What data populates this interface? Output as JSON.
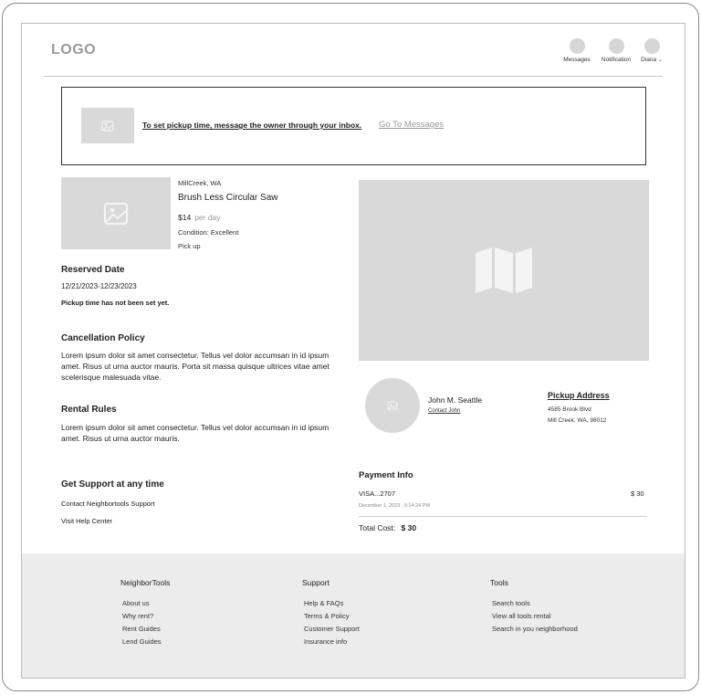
{
  "header": {
    "logo": "LOGO",
    "nav": [
      {
        "label": "Messages",
        "icon": "messages-icon"
      },
      {
        "label": "Notification",
        "icon": "notification-icon"
      },
      {
        "label": "Diana",
        "icon": "user-avatar-icon"
      }
    ]
  },
  "banner": {
    "message": "To set pickup time, message the owner through your inbox.",
    "link": "Go To Messages"
  },
  "item": {
    "location": "MillCreek, WA",
    "name": "Brush Less Circular Saw",
    "price": "$14",
    "price_unit": "per day",
    "condition": "Condition: Excellent",
    "pickup": "Pick up"
  },
  "reserved": {
    "title": "Reserved Date",
    "dates": "12/21/2023-12/23/2023",
    "note": "Pickup time has not been set yet."
  },
  "cancellation": {
    "title": "Cancellation Policy",
    "text": "Lorem ipsum dolor sit amet consectetur. Tellus vel dolor accumsan in id ipsum amet. Risus ut urna auctor mauris. Porta sit massa quisque ultrices vitae amet scelerisque malesuada vitae."
  },
  "rules": {
    "title": "Rental Rules",
    "text": "Lorem ipsum dolor sit amet consectetur. Tellus vel dolor accumsan in id ipsum amet. Risus ut urna auctor mauris."
  },
  "support": {
    "title": "Get Support at any time",
    "contact": "Contact Neighbortools Support",
    "help": "Visit Help Center"
  },
  "owner": {
    "name": "John M. Seattle",
    "contact": "Contact John"
  },
  "address": {
    "title": "Pickup Address",
    "line1": "4585 Brook Blvd",
    "line2": "Mill Creek, WA, 98012"
  },
  "payment": {
    "title": "Payment Info",
    "card": "VISA...2707",
    "amount": "$ 30",
    "date": "December 1, 2023 , 6:14:24 PM",
    "total_label": "Total Cost:",
    "total_value": "$ 30"
  },
  "footer": {
    "columns": [
      {
        "title": "NeighborTools",
        "links": [
          "About us",
          "Why rent?",
          "Rent  Guides",
          "Lend  Guides"
        ]
      },
      {
        "title": "Support",
        "links": [
          "Help & FAQs",
          "Terms & Policy",
          "Customer Support",
          "Insurance info"
        ]
      },
      {
        "title": "Tools",
        "links": [
          "Search tools",
          "View all tools rental",
          "Search in you neighborhood"
        ]
      }
    ]
  },
  "colors": {
    "placeholder": "#d9d9d9",
    "footer_bg": "#ececec",
    "muted": "#999999"
  }
}
